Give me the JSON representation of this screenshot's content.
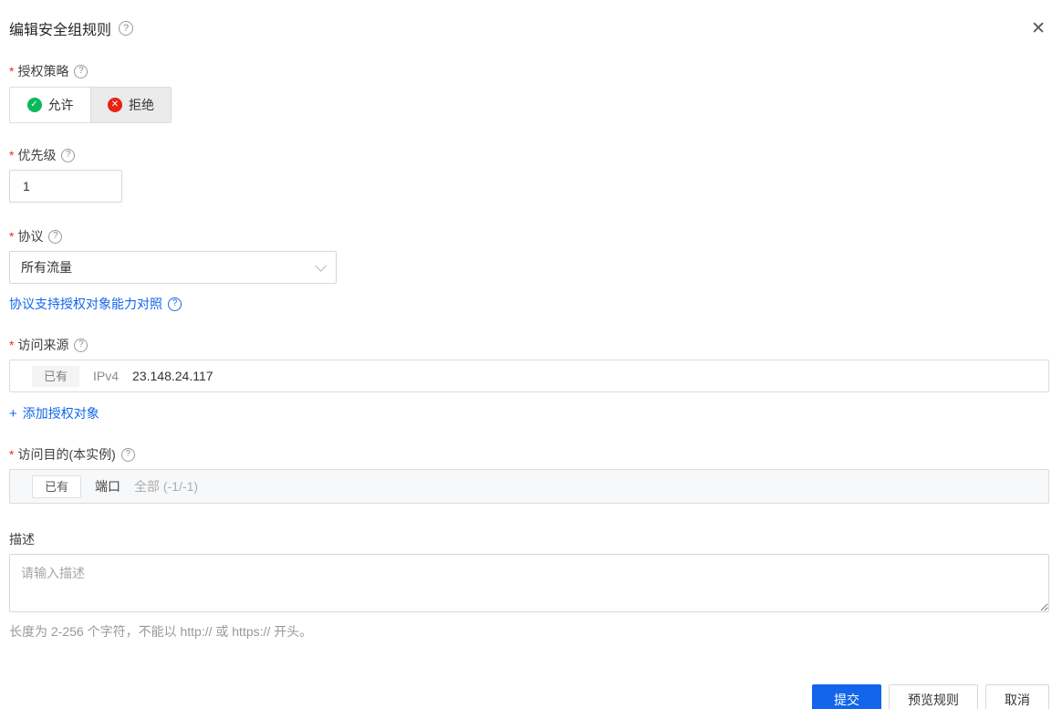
{
  "dialog": {
    "title": "编辑安全组规则"
  },
  "required_mark": "*",
  "icons": {
    "help": "?",
    "close": "✕",
    "check": "✓",
    "cross": "✕",
    "plus": "+"
  },
  "colors": {
    "accent_blue": "#1366ec",
    "allow_green": "#0cb75c",
    "deny_red": "#e62412",
    "required_red": "#eb2c2c",
    "border_gray": "#dcdcdc",
    "disabled_row_bg": "#f7f8fa"
  },
  "fields": {
    "policy": {
      "label": "授权策略",
      "options": [
        {
          "label": "允许",
          "selected": true
        },
        {
          "label": "拒绝",
          "selected": false
        }
      ]
    },
    "priority": {
      "label": "优先级",
      "value": "1"
    },
    "protocol": {
      "label": "协议",
      "selected": "所有流量"
    },
    "protocol_capability_link": {
      "label": "协议支持授权对象能力对照"
    },
    "source": {
      "label": "访问来源",
      "tag": "已有",
      "address_type": "IPv4",
      "value": "23.148.24.117"
    },
    "add_auth_object_link": {
      "label": "添加授权对象"
    },
    "destination": {
      "label": "访问目的(本实例)",
      "tag": "已有",
      "port_label": "端口",
      "value": "全部 (-1/-1)"
    },
    "description": {
      "label": "描述",
      "placeholder": "请输入描述",
      "hint": "长度为 2-256 个字符，不能以 http:// 或 https:// 开头。"
    }
  },
  "footer": {
    "submit": "提交",
    "preview": "预览规则",
    "cancel": "取消"
  }
}
